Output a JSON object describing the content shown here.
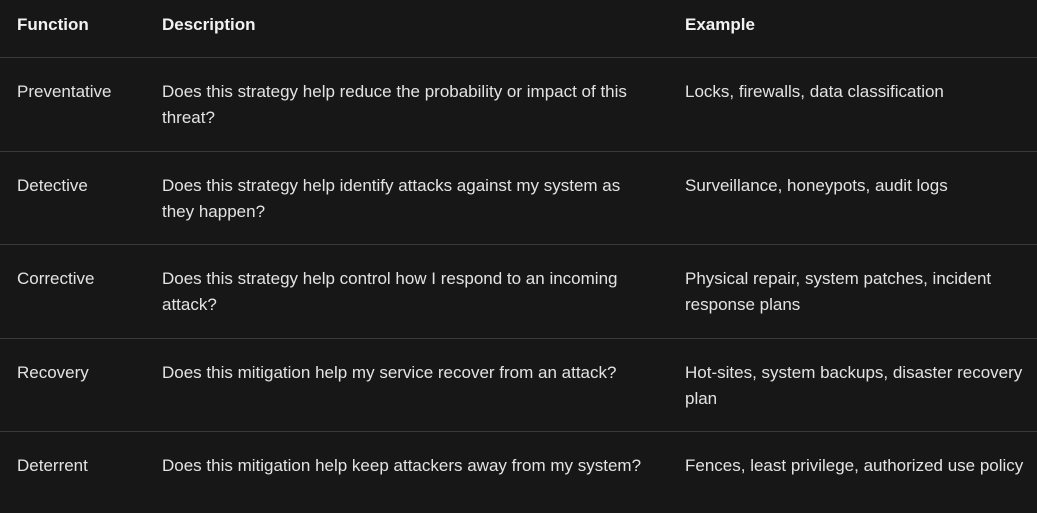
{
  "columns": [
    "Function",
    "Description",
    "Example"
  ],
  "rows": [
    {
      "function": "Preventative",
      "description": "Does this strategy help reduce the probability or impact of this threat?",
      "example": "Locks, firewalls, data classification"
    },
    {
      "function": "Detective",
      "description": "Does this strategy help identify attacks against my system as they happen?",
      "example": "Surveillance, honeypots, audit logs"
    },
    {
      "function": "Corrective",
      "description": "Does this strategy help control how I respond to an incoming attack?",
      "example": "Physical repair, system patches, incident response plans"
    },
    {
      "function": "Recovery",
      "description": "Does this mitigation help my service recover from an attack?",
      "example": "Hot-sites, system backups, disaster recovery plan"
    },
    {
      "function": "Deterrent",
      "description": "Does this mitigation help keep attackers away from my system?",
      "example": "Fences, least privilege, authorized use policy"
    }
  ],
  "colors": {
    "background": "#171717",
    "divider": "#3a3a3a",
    "text": "#e3e3e3"
  }
}
